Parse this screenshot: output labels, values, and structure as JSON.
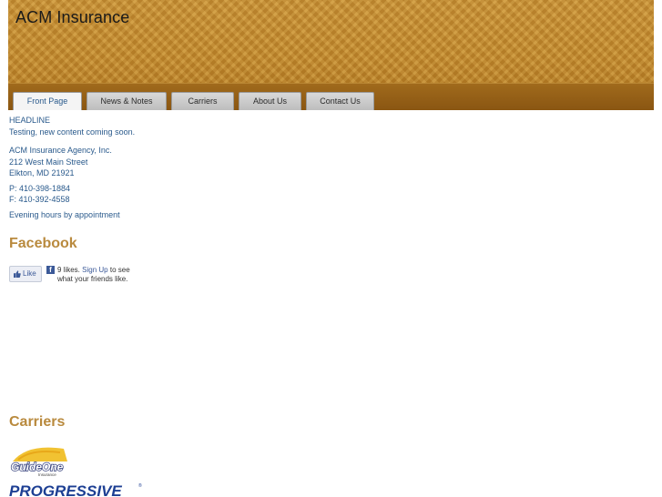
{
  "header": {
    "site_title": "ACM Insurance"
  },
  "nav": {
    "tabs": [
      {
        "label": "Front Page",
        "active": true
      },
      {
        "label": "News & Notes"
      },
      {
        "label": "Carriers"
      },
      {
        "label": "About Us"
      },
      {
        "label": "Contact Us"
      }
    ]
  },
  "main": {
    "headline": "HEADLINE",
    "intro": "Testing, new content coming soon.",
    "address": [
      "ACM Insurance Agency, Inc.",
      "212 West Main Street",
      "Elkton, MD 21921"
    ],
    "phone": "P: 410-398-1884",
    "fax": "F: 410-392-4558",
    "hours": "Evening hours by appointment"
  },
  "facebook": {
    "heading": "Facebook",
    "like_label": "Like",
    "likes_text": "9 likes.",
    "signup_link": "Sign Up",
    "suffix_text": "to see what your friends like."
  },
  "carriers": {
    "heading": "Carriers",
    "logos": [
      "GuideOne Insurance",
      "PROGRESSIVE"
    ],
    "guideone_tagline": "Insurance"
  },
  "colors": {
    "accent": "#b98a3e",
    "link": "#2a5a8c",
    "header_gold": "#c99236",
    "nav_brown": "#8a5612"
  }
}
